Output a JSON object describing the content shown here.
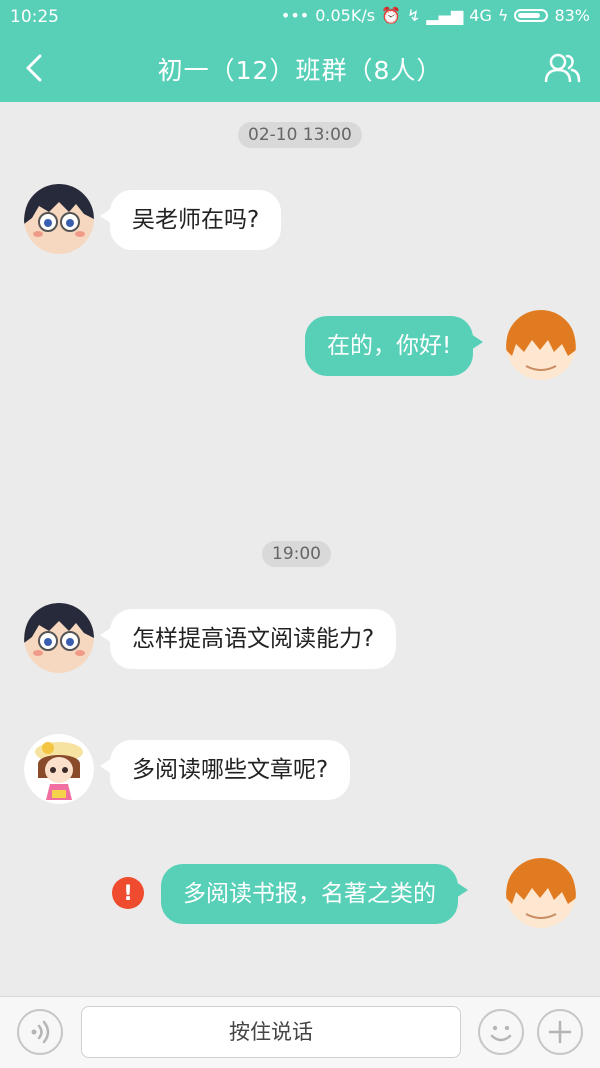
{
  "status_bar": {
    "time": "10:25",
    "network_speed": "0.05K/s",
    "network_type": "4G",
    "battery": "83%"
  },
  "header": {
    "title": "初一（12）班群（8人）"
  },
  "messages": [
    {
      "type": "timestamp",
      "text": "02-10  13:00"
    },
    {
      "side": "left",
      "avatar": "boy-glasses",
      "text": "吴老师在吗?"
    },
    {
      "side": "right",
      "avatar": "orange-hair",
      "text": "在的，你好!"
    },
    {
      "type": "timestamp",
      "text": "19:00"
    },
    {
      "side": "left",
      "avatar": "boy-glasses",
      "text": "怎样提高语文阅读能力?"
    },
    {
      "side": "left",
      "avatar": "girl-flower",
      "text": "多阅读哪些文章呢?"
    },
    {
      "side": "right",
      "avatar": "orange-hair",
      "text": "多阅读书报，名著之类的",
      "status": "failed"
    }
  ],
  "input_bar": {
    "hold_to_talk_label": "按住说话"
  },
  "colors": {
    "accent": "#58d0b8",
    "error": "#ef4b2e",
    "background": "#ebebeb"
  }
}
